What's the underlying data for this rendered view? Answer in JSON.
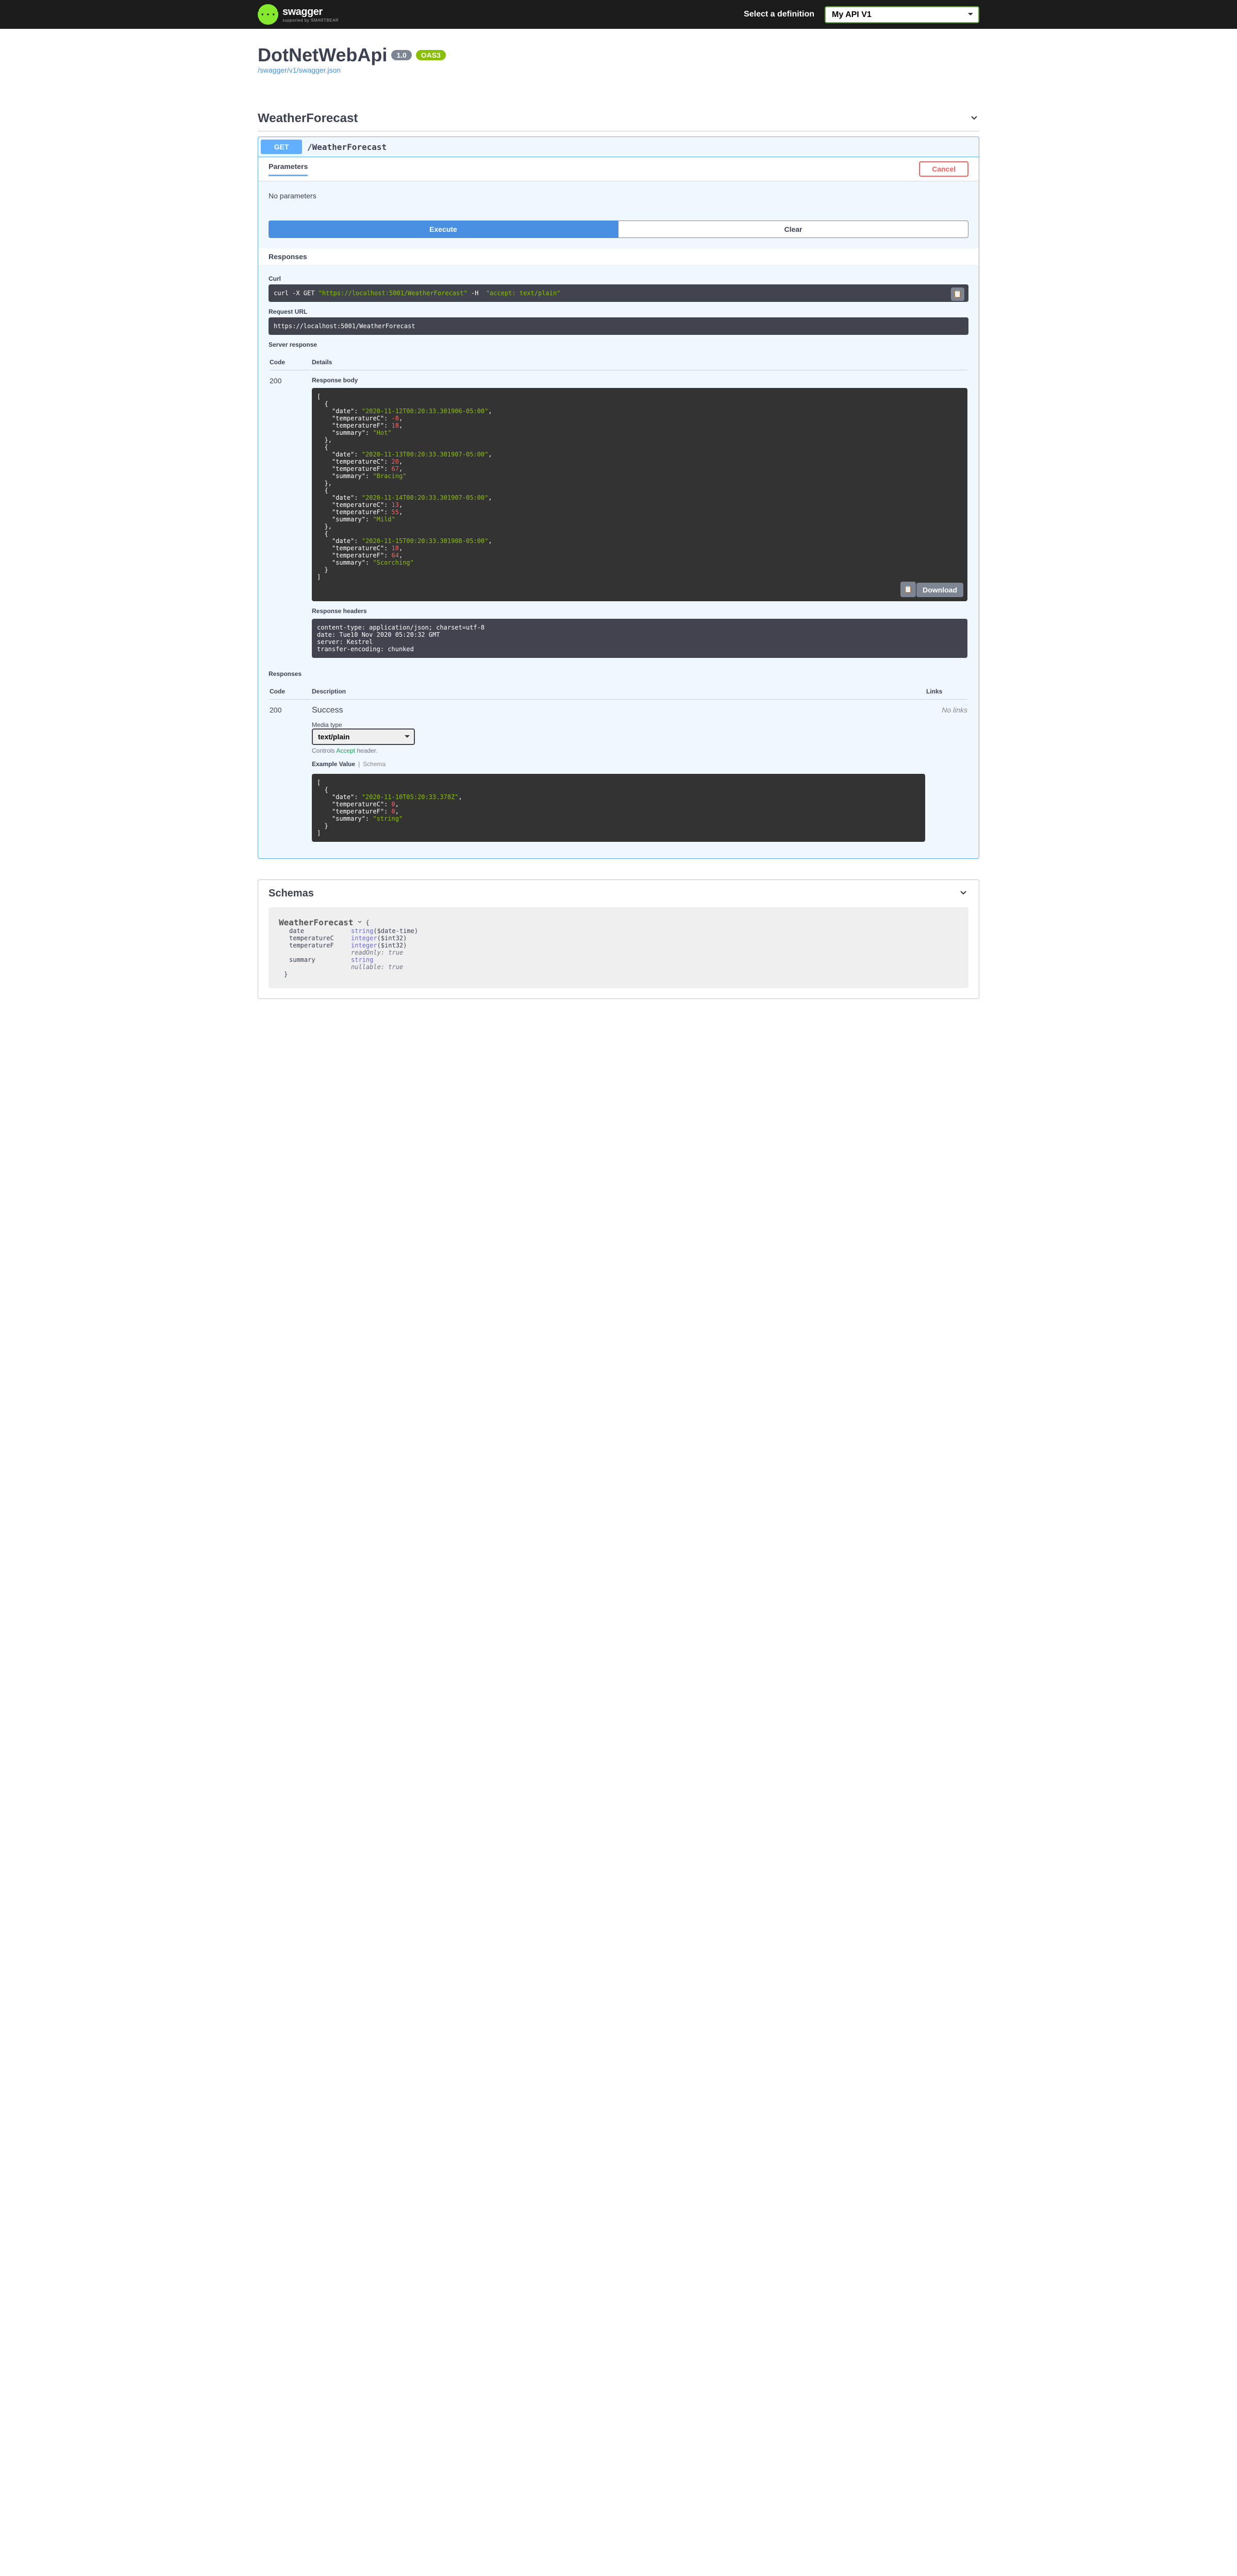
{
  "topbar": {
    "logo_glyph": "{···}",
    "logo_main": "swagger",
    "logo_sub": "supported by SMARTBEAR",
    "select_label": "Select a definition",
    "definition": "My API V1"
  },
  "info": {
    "title": "DotNetWebApi",
    "version": "1.0",
    "oas": "OAS3",
    "spec_url": "/swagger/v1/swagger.json"
  },
  "tag": {
    "name": "WeatherForecast"
  },
  "op": {
    "method": "GET",
    "path": "/WeatherForecast",
    "params_header": "Parameters",
    "cancel": "Cancel",
    "no_params": "No parameters",
    "execute": "Execute",
    "clear": "Clear",
    "responses_header": "Responses",
    "curl_label": "Curl",
    "curl_cmd_prefix": "curl -X GET ",
    "curl_url": "\"https://localhost:5001/WeatherForecast\"",
    "curl_h": " -H ",
    "curl_accept": " \"accept: text/plain\"",
    "request_url_label": "Request URL",
    "request_url": "https://localhost:5001/WeatherForecast",
    "server_response_label": "Server response",
    "code_h": "Code",
    "details_h": "Details",
    "code_200": "200",
    "resp_body_label": "Response body",
    "resp_headers_label": "Response headers",
    "download": "Download",
    "headers": "content-type: application/json; charset=utf-8 \ndate: Tue10 Nov 2020 05:20:32 GMT \nserver: Kestrel \ntransfer-encoding: chunked ",
    "body_items": [
      {
        "date": "2020-11-12T00:20:33.301906-05:00",
        "temperatureC": -8,
        "temperatureF": 18,
        "summary": "Hot"
      },
      {
        "date": "2020-11-13T00:20:33.301907-05:00",
        "temperatureC": 20,
        "temperatureF": 67,
        "summary": "Bracing"
      },
      {
        "date": "2020-11-14T00:20:33.301907-05:00",
        "temperatureC": 13,
        "temperatureF": 55,
        "summary": "Mild"
      },
      {
        "date": "2020-11-15T00:20:33.301908-05:00",
        "temperatureC": 18,
        "temperatureF": 64,
        "summary": "Scorching"
      }
    ]
  },
  "documented": {
    "responses_label": "Responses",
    "code_h": "Code",
    "description_h": "Description",
    "links_h": "Links",
    "code_200": "200",
    "desc": "Success",
    "no_links": "No links",
    "media_label": "Media type",
    "media_value": "text/plain",
    "accept_note_prefix": "Controls ",
    "accept_note_code": "Accept",
    "accept_note_suffix": " header.",
    "example_tab": "Example Value",
    "schema_tab": "Schema",
    "example_prefix": "[\n  {\n    \"date\": ",
    "example_date": "\"2020-11-10T05:20:33.378Z\"",
    "example_mid1": ",\n    \"temperatureC\": ",
    "example_tc": "0",
    "example_mid2": ",\n    \"temperatureF\": ",
    "example_tf": "0",
    "example_mid3": ",\n    \"summary\": ",
    "example_summary": "\"string\"",
    "example_suffix": "\n  }\n]"
  },
  "schemas": {
    "header": "Schemas",
    "model": "WeatherForecast",
    "brace_open": "{",
    "brace_close": "}",
    "rows": [
      {
        "name": "date",
        "type": "string",
        "format": "($date-time)"
      },
      {
        "name": "temperatureC",
        "type": "integer",
        "format": "($int32)"
      },
      {
        "name": "temperatureF",
        "type": "integer",
        "format": "($int32)",
        "meta1": "readOnly: true"
      },
      {
        "name": "summary",
        "type": "string",
        "meta1": "nullable: true"
      }
    ]
  }
}
